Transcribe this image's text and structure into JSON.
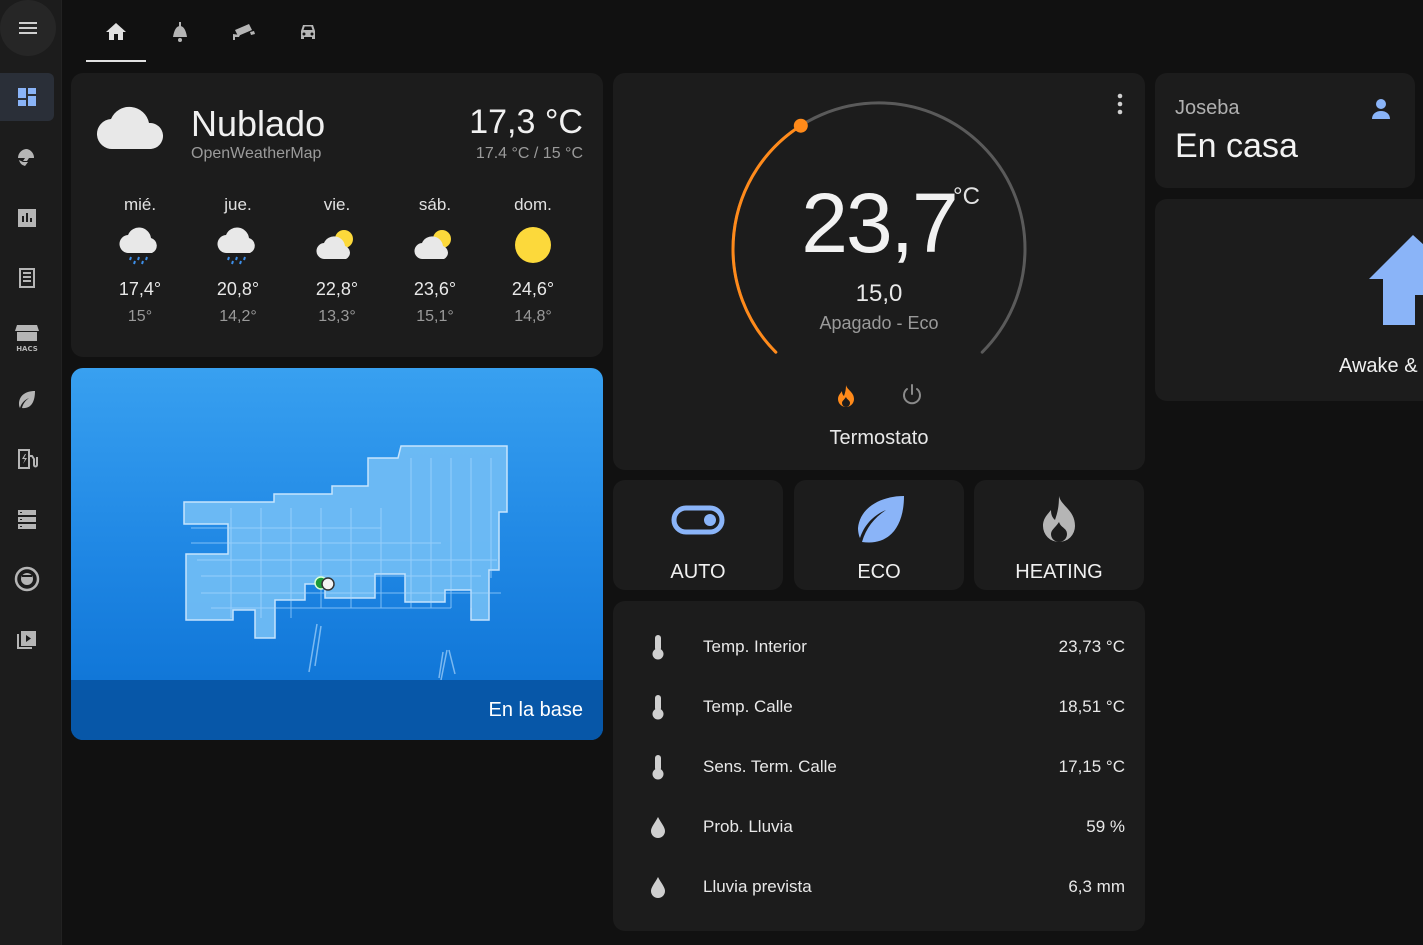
{
  "tabs": [
    {
      "icon": "home-icon",
      "active": true
    },
    {
      "icon": "ceiling-lamp-icon",
      "active": false
    },
    {
      "icon": "cctv-camera-icon",
      "active": false
    },
    {
      "icon": "car-icon",
      "active": false
    }
  ],
  "sidebar": {
    "items": [
      {
        "icon": "dashboard-icon",
        "active": true
      },
      {
        "icon": "brain-energy-icon"
      },
      {
        "icon": "history-chart-icon"
      },
      {
        "icon": "logbook-icon"
      },
      {
        "icon": "hacs-store-icon",
        "label": "HACS"
      },
      {
        "icon": "leaf-icon"
      },
      {
        "icon": "ev-station-icon"
      },
      {
        "icon": "server-list-icon"
      },
      {
        "icon": "robot-vacuum-icon"
      },
      {
        "icon": "media-play-icon"
      }
    ]
  },
  "weather": {
    "condition": "Nublado",
    "source": "OpenWeatherMap",
    "temperature": "17,3 °C",
    "range": "17.4 °C / 15 °C",
    "forecast": [
      {
        "day": "mié.",
        "icon": "rain-cloud-icon",
        "high": "17,4°",
        "low": "15°"
      },
      {
        "day": "jue.",
        "icon": "rain-cloud-icon",
        "high": "20,8°",
        "low": "14,2°"
      },
      {
        "day": "vie.",
        "icon": "partly-cloudy-icon",
        "high": "22,8°",
        "low": "13,3°"
      },
      {
        "day": "sáb.",
        "icon": "partly-cloudy-icon",
        "high": "23,6°",
        "low": "15,1°"
      },
      {
        "day": "dom.",
        "icon": "sun-icon",
        "high": "24,6°",
        "low": "14,8°"
      }
    ]
  },
  "vacuum": {
    "status": "En la base"
  },
  "thermostat": {
    "current": "23,7",
    "unit": "°C",
    "target": "15,0",
    "mode": "Apagado - Eco",
    "name": "Termostato",
    "arc_fraction": 0.38
  },
  "modes": [
    {
      "label": "AUTO",
      "icon": "toggle-icon"
    },
    {
      "label": "ECO",
      "icon": "leaf-icon"
    },
    {
      "label": "HEATING",
      "icon": "fire-icon"
    }
  ],
  "sensors": [
    {
      "name": "Temp. Interior",
      "value": "23,73 °C",
      "icon": "thermometer-icon"
    },
    {
      "name": "Temp. Calle",
      "value": "18,51 °C",
      "icon": "thermometer-icon"
    },
    {
      "name": "Sens. Term. Calle",
      "value": "17,15 °C",
      "icon": "thermometer-icon"
    },
    {
      "name": "Prob. Lluvia",
      "value": "59 %",
      "icon": "water-drop-icon"
    },
    {
      "name": "Lluvia prevista",
      "value": "6,3 mm",
      "icon": "water-drop-icon"
    }
  ],
  "person": {
    "name": "Joseba",
    "state": "En casa"
  },
  "awake": {
    "label": "Awake &"
  },
  "colors": {
    "accent": "#8ab4f8",
    "heat": "#ff8a1a",
    "card": "#1c1c1c",
    "background": "#111111"
  }
}
